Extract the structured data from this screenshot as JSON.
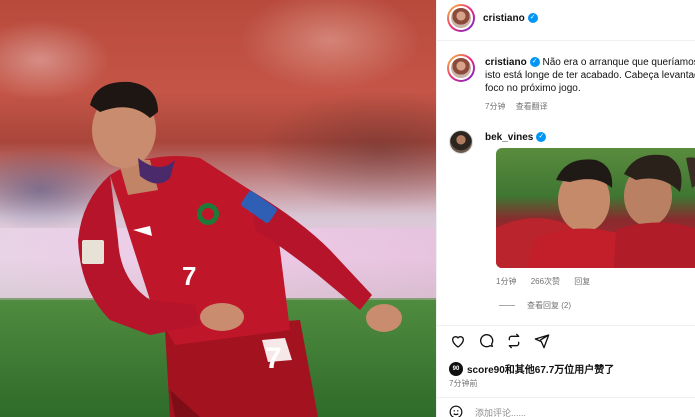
{
  "post": {
    "author": "cristiano",
    "verified": true
  },
  "caption": {
    "author": "cristiano",
    "lines": [
      "Não era o arranque que queríamos,",
      "isto está longe de ter acabado. Cabeça levantada e",
      "foco no próximo jogo."
    ],
    "time": "7分钟",
    "translate": "查看翻译"
  },
  "comment": {
    "author": "bek_vines",
    "verified": true,
    "time": "1分钟",
    "likes": "266次赞",
    "reply": "回复",
    "view_replies": "查看回复 (2)"
  },
  "actions": [
    "heart-icon",
    "comment-icon",
    "repost-icon",
    "share-icon"
  ],
  "likes": {
    "badge": "90",
    "text": "score90和其他67.7万位用户赞了"
  },
  "posted_ago": "7分钟前",
  "add_comment_placeholder": "添加评论......",
  "colors": {
    "verified": "#0095f6",
    "jersey": "#c0162a",
    "muted": "#737373"
  }
}
